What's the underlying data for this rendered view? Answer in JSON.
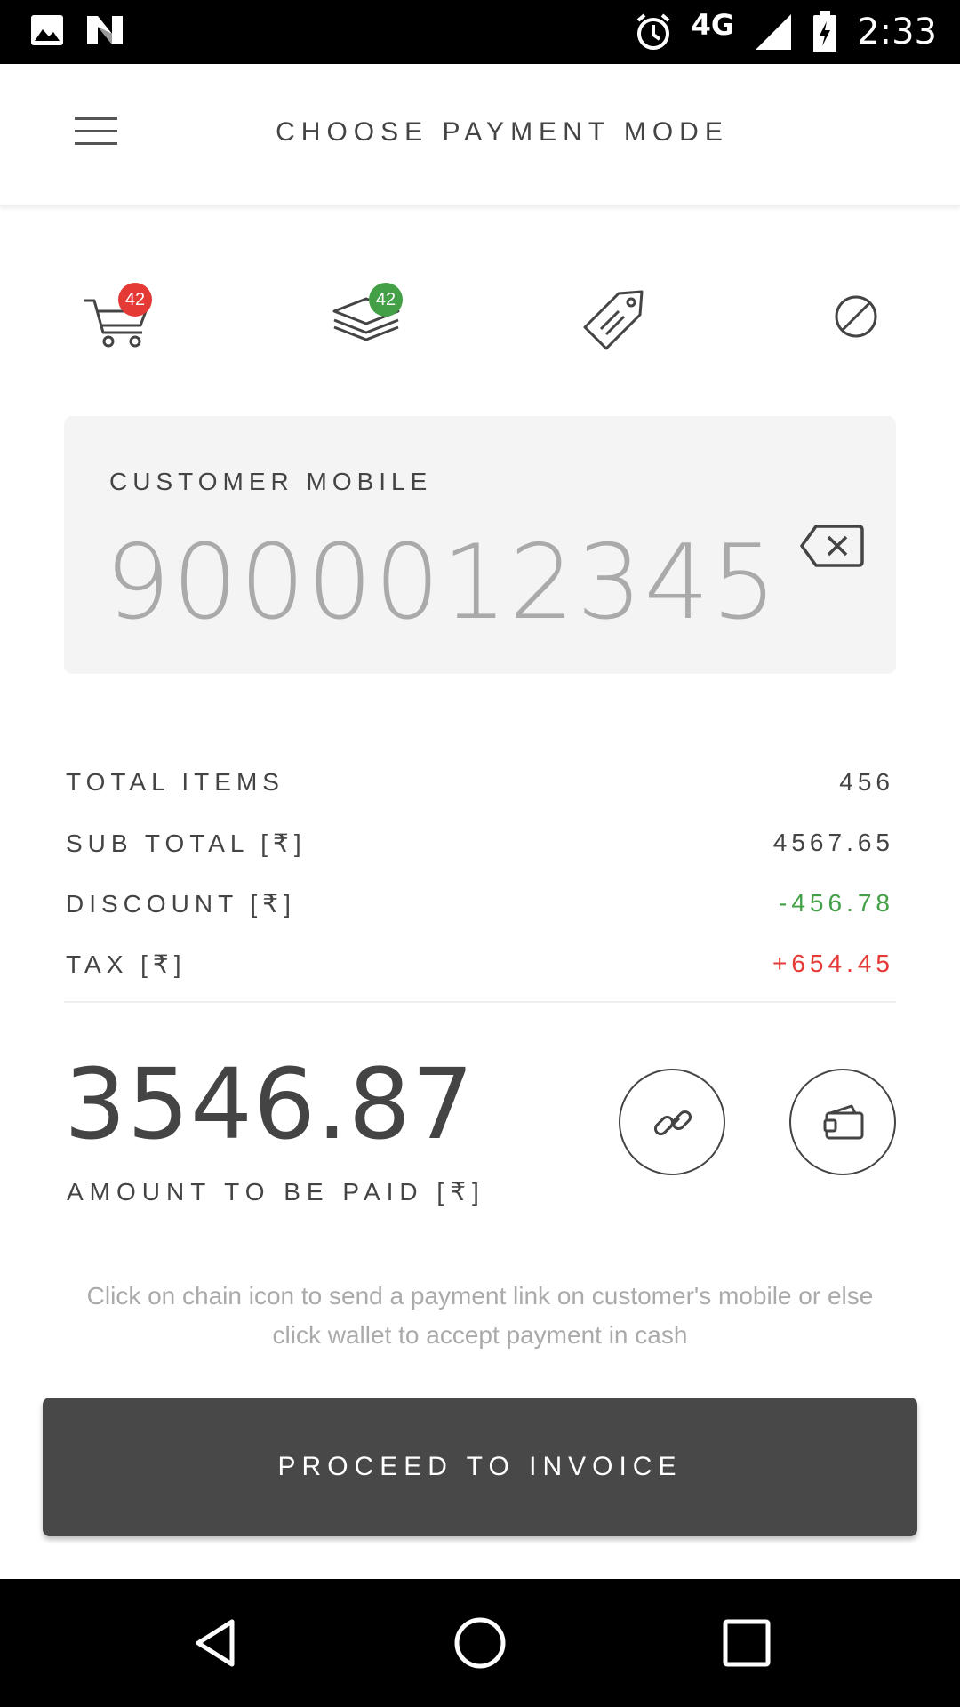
{
  "status_bar": {
    "time": "2:33",
    "network": "4G",
    "icons": [
      "image-icon",
      "n-icon",
      "alarm-icon",
      "signal-icon",
      "battery-charging-icon"
    ]
  },
  "app_bar": {
    "title": "CHOOSE PAYMENT MODE",
    "menu_icon": "hamburger-menu-icon"
  },
  "tabs": [
    {
      "icon": "cart-icon",
      "badge": "42",
      "badge_color": "#e53935"
    },
    {
      "icon": "layers-icon",
      "badge": "42",
      "badge_color": "#43a047"
    },
    {
      "icon": "tag-icon"
    },
    {
      "icon": "no-entry-icon"
    }
  ],
  "customer": {
    "label": "CUSTOMER MOBILE",
    "mobile": "9000012345",
    "clear_icon": "backspace-icon"
  },
  "summary": {
    "total_items_label": "TOTAL ITEMS",
    "total_items_value": "456",
    "sub_total_label": "SUB TOTAL [₹]",
    "sub_total_value": "4567.65",
    "discount_label": "DISCOUNT [₹]",
    "discount_value": "-456.78",
    "tax_label": "TAX [₹]",
    "tax_value": "+654.45"
  },
  "amount": {
    "value": "3546.87",
    "label": "AMOUNT TO BE PAID [₹]"
  },
  "actions": {
    "link_icon": "chain-link-icon",
    "wallet_icon": "wallet-icon"
  },
  "hint": "Click on chain icon to send a payment link on customer's mobile or else click wallet to accept payment in cash",
  "proceed_label": "PROCEED TO INVOICE",
  "colors": {
    "green": "#43a047",
    "red": "#e53935",
    "button_bg": "#484848",
    "card_bg": "#f4f4f4"
  },
  "nav_bar": {
    "icons": [
      "back-icon",
      "home-icon",
      "recents-icon"
    ]
  }
}
